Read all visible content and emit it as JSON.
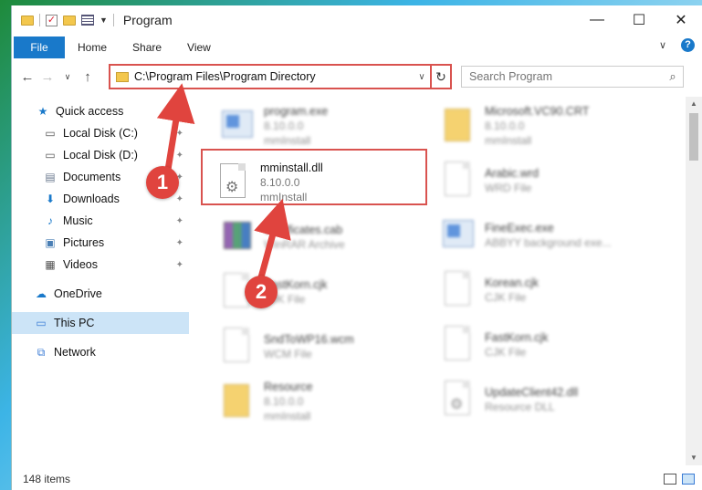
{
  "window": {
    "title": "Program"
  },
  "ribbon": {
    "file": "File",
    "tabs": [
      "Home",
      "Share",
      "View"
    ]
  },
  "address": {
    "path": "C:\\Program Files\\Program Directory"
  },
  "search": {
    "placeholder": "Search Program"
  },
  "nav": [
    {
      "label": "Quick access",
      "icon": "star-icon",
      "pinned": false
    },
    {
      "label": "Local Disk (C:)",
      "icon": "drive-icon",
      "pinned": true
    },
    {
      "label": "Local Disk (D:)",
      "icon": "drive-icon",
      "pinned": true
    },
    {
      "label": "Documents",
      "icon": "documents-icon",
      "pinned": true
    },
    {
      "label": "Downloads",
      "icon": "download-icon",
      "pinned": true
    },
    {
      "label": "Music",
      "icon": "music-icon",
      "pinned": true
    },
    {
      "label": "Pictures",
      "icon": "pictures-icon",
      "pinned": true
    },
    {
      "label": "Videos",
      "icon": "videos-icon",
      "pinned": true
    },
    {
      "label": "OneDrive",
      "icon": "cloud-icon",
      "pinned": false
    },
    {
      "label": "This PC",
      "icon": "computer-icon",
      "pinned": false,
      "selected": true
    },
    {
      "label": "Network",
      "icon": "network-icon",
      "pinned": false
    }
  ],
  "files": [
    {
      "name": "program.exe",
      "meta1": "8.10.0.0",
      "meta2": "mmInstall",
      "icon": "exe"
    },
    {
      "name": "Microsoft.VC90.CRT",
      "meta1": "8.10.0.0",
      "meta2": "mmInstall",
      "icon": "folder"
    },
    {
      "name": "mminstall.dll",
      "meta1": "8.10.0.0",
      "meta2": "mmInstall",
      "icon": "dll"
    },
    {
      "name": "Arabic.wrd",
      "meta1": "WRD File",
      "meta2": "",
      "icon": "doc"
    },
    {
      "name": "Certificates.cab",
      "meta1": "WinRAR Archive",
      "meta2": "",
      "icon": "rar"
    },
    {
      "name": "FineExec.exe",
      "meta1": "ABBYY background exe...",
      "meta2": "",
      "icon": "app"
    },
    {
      "name": "FastKorn.cjk",
      "meta1": "CJK File",
      "meta2": "",
      "icon": "doc"
    },
    {
      "name": "Korean.cjk",
      "meta1": "CJK File",
      "meta2": "",
      "icon": "doc"
    },
    {
      "name": "SndToWP16.wcm",
      "meta1": "WCM File",
      "meta2": "",
      "icon": "doc"
    },
    {
      "name": "FastKorn.cjk",
      "meta1": "CJK File",
      "meta2": "",
      "icon": "doc"
    },
    {
      "name": "Resource",
      "meta1": "8.10.0.0",
      "meta2": "mmInstall",
      "icon": "folder"
    },
    {
      "name": "UpdateClient42.dll",
      "meta1": "Resource DLL",
      "meta2": "",
      "icon": "dll"
    }
  ],
  "status": {
    "count": "148 items"
  },
  "annotations": {
    "step1": "1",
    "step2": "2"
  },
  "colors": {
    "accent": "#1979ca",
    "highlight": "#d9534f",
    "badge": "#e0443e"
  }
}
